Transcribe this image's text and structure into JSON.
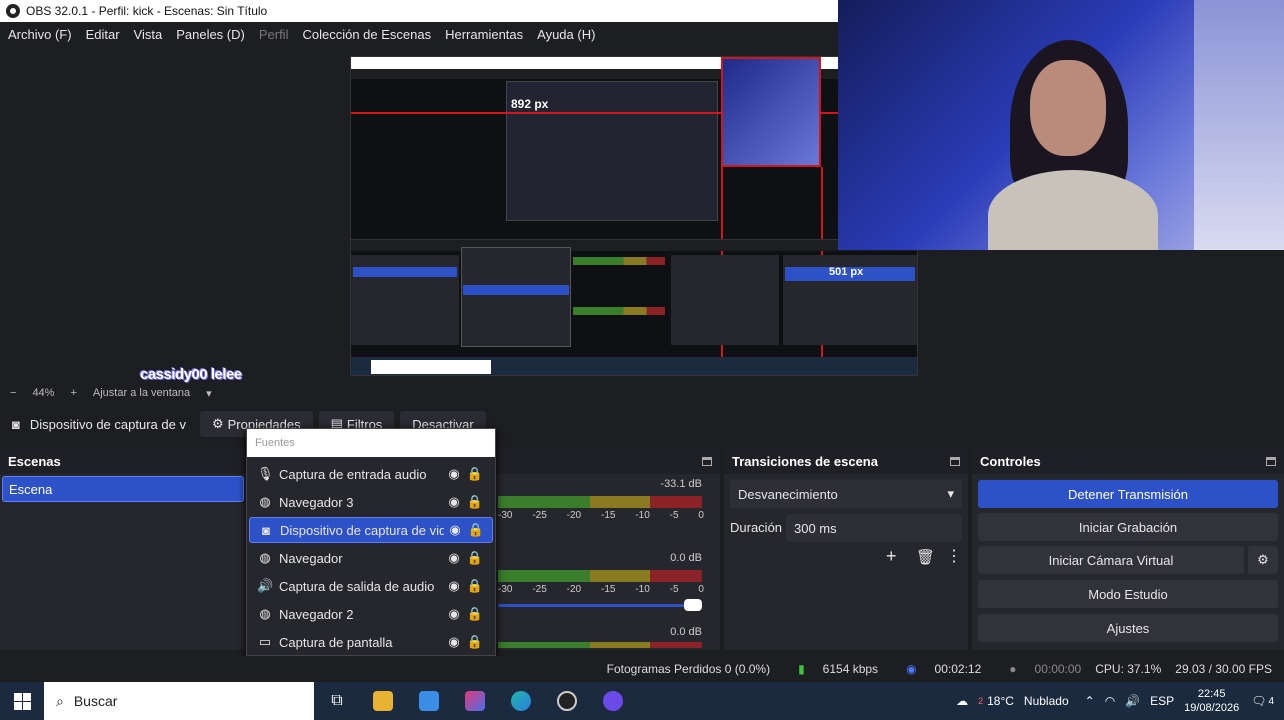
{
  "window": {
    "title": "OBS 32.0.1 - Perfil: kick - Escenas: Sin Título"
  },
  "menu": [
    {
      "label": "Archivo (F)",
      "enabled": true
    },
    {
      "label": "Editar",
      "enabled": true
    },
    {
      "label": "Vista",
      "enabled": true
    },
    {
      "label": "Paneles (D)",
      "enabled": true
    },
    {
      "label": "Perfil",
      "enabled": false
    },
    {
      "label": "Colección de Escenas",
      "enabled": true
    },
    {
      "label": "Herramientas",
      "enabled": true
    },
    {
      "label": "Ayuda (H)",
      "enabled": true
    }
  ],
  "preview": {
    "overlay_text": "cassidy00 lelee",
    "nested_dims_label_1": "892 px",
    "nested_dims_label_2": "501 px"
  },
  "zoom": {
    "minus": "−",
    "level": "44%",
    "plus": "+",
    "fit_label": "Ajustar a la ventana"
  },
  "source_toolbar": {
    "source_name": "Dispositivo de captura de v",
    "properties": "Propiedades",
    "filters": "Filtros",
    "deactivate": "Desactivar"
  },
  "scenes": {
    "title": "Escenas",
    "items": [
      "Escena"
    ]
  },
  "sources": {
    "header": "Fuentes",
    "items": [
      {
        "label": "Captura de entrada audio",
        "icon": "microphone-icon",
        "glyph": "🎙"
      },
      {
        "label": "Navegador 3",
        "icon": "globe-icon",
        "glyph": "◍"
      },
      {
        "label": "Dispositivo de captura de vid",
        "icon": "camera-icon",
        "glyph": "◙",
        "selected": true
      },
      {
        "label": "Navegador",
        "icon": "globe-icon",
        "glyph": "◍"
      },
      {
        "label": "Captura de salida de audio",
        "icon": "speaker-icon",
        "glyph": "🔊"
      },
      {
        "label": "Navegador 2",
        "icon": "globe-icon",
        "glyph": "◍"
      },
      {
        "label": "Captura de pantalla",
        "icon": "monitor-icon",
        "glyph": "▭"
      }
    ]
  },
  "mixer": {
    "channels": [
      {
        "db": "-33.1 dB"
      },
      {
        "db": "0.0 dB"
      },
      {
        "db": "0.0 dB"
      }
    ],
    "ticks": [
      "-30",
      "-25",
      "-20",
      "-15",
      "-10",
      "-5",
      "0"
    ]
  },
  "transitions": {
    "title": "Transiciones de escena",
    "selected": "Desvanecimiento",
    "duration_label": "Duración",
    "duration_value": "300 ms"
  },
  "controls": {
    "title": "Controles",
    "stop_streaming": "Detener Transmisión",
    "start_recording": "Iniciar Grabación",
    "start_virtual_cam": "Iniciar Cámara Virtual",
    "studio_mode": "Modo Estudio",
    "settings": "Ajustes"
  },
  "status": {
    "dropped_frames": "Fotogramas Perdidos 0 (0.0%)",
    "bitrate": "6154 kbps",
    "stream_time": "00:02:12",
    "record_time": "00:00:00",
    "cpu": "CPU: 37.1%",
    "fps": "29.03 / 30.00 FPS"
  },
  "taskbar": {
    "search_placeholder": "Buscar",
    "weather_temp": "18°C",
    "weather_desc": "Nublado",
    "weather_badge": "2",
    "language": "ESP",
    "time": "22:45",
    "date": "19/08/2026",
    "notif_count": "4"
  },
  "colors": {
    "accent": "#2d51c6",
    "bg": "#1d1e22",
    "panel": "#26272d"
  }
}
